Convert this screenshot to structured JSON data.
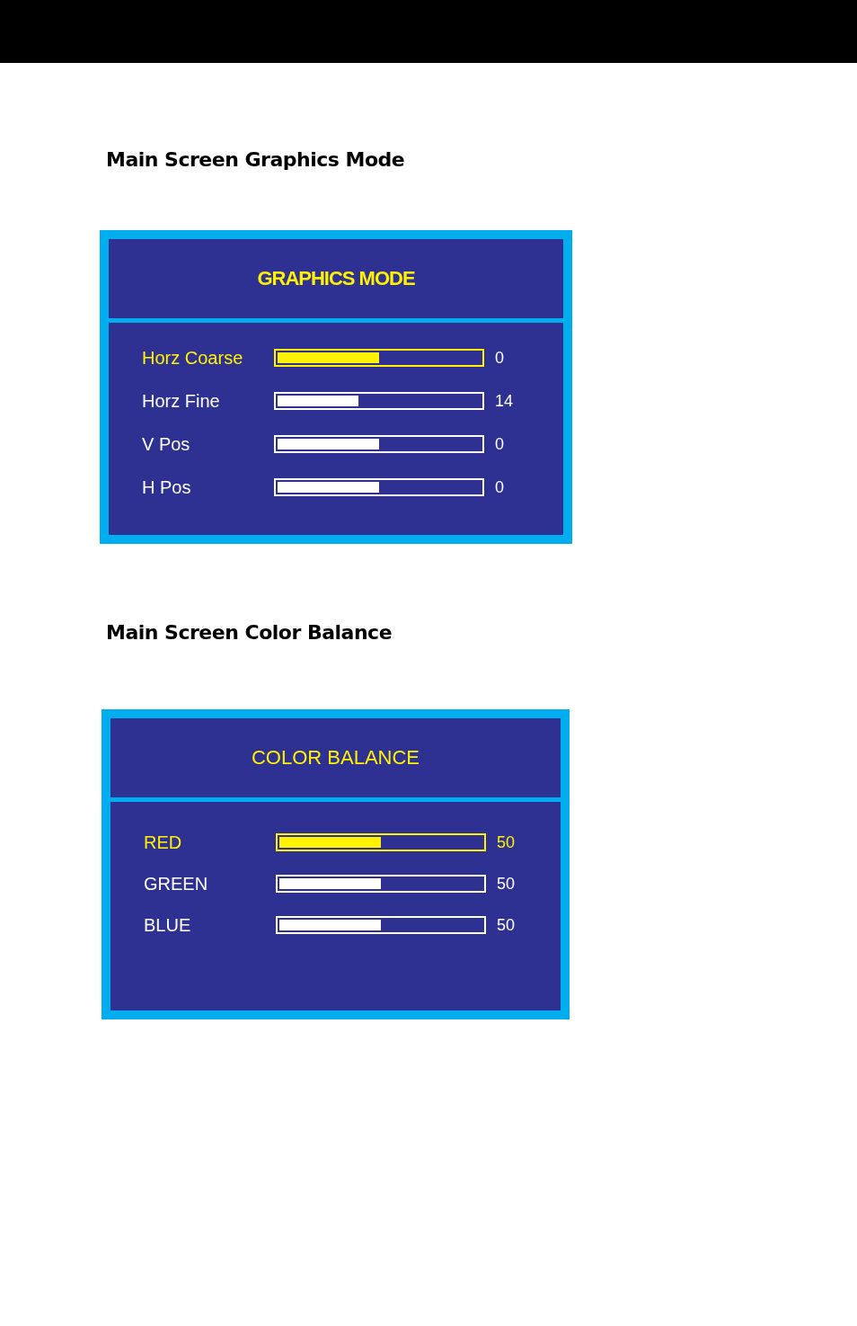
{
  "sections": [
    {
      "heading": "Main Screen Graphics Mode",
      "panel": {
        "title": "GRAPHICS MODE",
        "title_bold": true,
        "rows": [
          {
            "label": "Horz Coarse",
            "selected": true,
            "level": 0.5,
            "reading": "0",
            "reading_highlighted": false
          },
          {
            "label": "Horz Fine",
            "selected": false,
            "level": 0.4,
            "reading": "14",
            "reading_highlighted": false
          },
          {
            "label": "V Pos",
            "selected": false,
            "level": 0.5,
            "reading": "0",
            "reading_highlighted": false
          },
          {
            "label": "H Pos",
            "selected": false,
            "level": 0.5,
            "reading": "0",
            "reading_highlighted": false
          }
        ]
      }
    },
    {
      "heading": "Main Screen Color Balance",
      "panel": {
        "title": "COLOR BALANCE",
        "title_bold": false,
        "rows": [
          {
            "label": "RED",
            "selected": true,
            "level": 0.5,
            "reading": "50",
            "reading_highlighted": true
          },
          {
            "label": "GREEN",
            "selected": false,
            "level": 0.5,
            "reading": "50",
            "reading_highlighted": false
          },
          {
            "label": "BLUE",
            "selected": false,
            "level": 0.5,
            "reading": "50",
            "reading_highlighted": false
          }
        ]
      }
    }
  ]
}
